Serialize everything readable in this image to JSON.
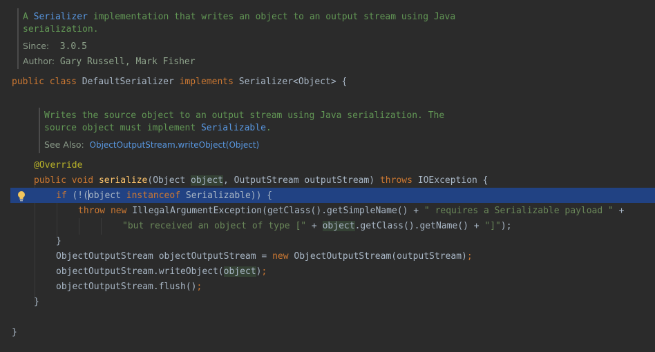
{
  "class_doc": {
    "line1_a": "A ",
    "line1_link": "Serializer",
    "line1_b": " implementation that writes an object to an output stream using Java",
    "line2": "serialization.",
    "since_tag": "Since:",
    "since_value": "3.0.5",
    "author_tag": "Author:",
    "author_value": "Gary Russell, Mark Fisher"
  },
  "class_decl": {
    "public": "public",
    "class": "class",
    "name": " DefaultSerializer ",
    "implements": "implements",
    "iface": " Serializer<Object> {"
  },
  "method_doc": {
    "line1": "Writes the source object to an output stream using Java serialization. The",
    "line2_a": "source object must implement ",
    "line2_link": "Serializable",
    "line2_b": ".",
    "see_tag": "See Also:",
    "see_link": "ObjectOutputStream.writeObject(Object)"
  },
  "code": {
    "annotation": "@Override",
    "sig_public": "public",
    "sig_void": "void",
    "sig_name": "serialize",
    "sig_p1": "(Object ",
    "sig_p1_name": "object",
    "sig_p2": ", OutputStream outputStream) ",
    "sig_throws": "throws",
    "sig_exc": " IOException {",
    "if_kw": "if",
    "if_a": " (!(",
    "if_obj": "object",
    "if_instanceof": "instanceof",
    "if_b": " Serializable)) {",
    "throw_kw": "throw",
    "new_kw": "new",
    "throw_a": " IllegalArgumentException(getClass().getSimpleName() + ",
    "throw_str1": "\" requires a Serializable payload \"",
    "throw_b": " +",
    "cont_str": "\"but received an object of type [\"",
    "cont_a": " + ",
    "cont_obj": "object",
    "cont_b": ".getClass().getName() + ",
    "cont_str2": "\"]\"",
    "cont_c": ");",
    "close_if": "}",
    "oos_a": "ObjectOutputStream objectOutputStream = ",
    "oos_new": "new",
    "oos_b": " ObjectOutputStream(outputStream)",
    "oos_semi": ";",
    "write_a": "objectOutputStream.writeObject(",
    "write_obj": "object",
    "write_b": ")",
    "write_semi": ";",
    "flush_a": "objectOutputStream.flush()",
    "flush_semi": ";",
    "close_method": "}",
    "close_class": "}"
  },
  "colors": {
    "background": "#2b2b2b",
    "keyword": "#cc7832",
    "method": "#ffc66d",
    "annotation": "#bbb529",
    "string": "#6a8759",
    "doc": "#629755",
    "selection": "#214283"
  },
  "icons": {
    "intention": "lightbulb-icon"
  }
}
